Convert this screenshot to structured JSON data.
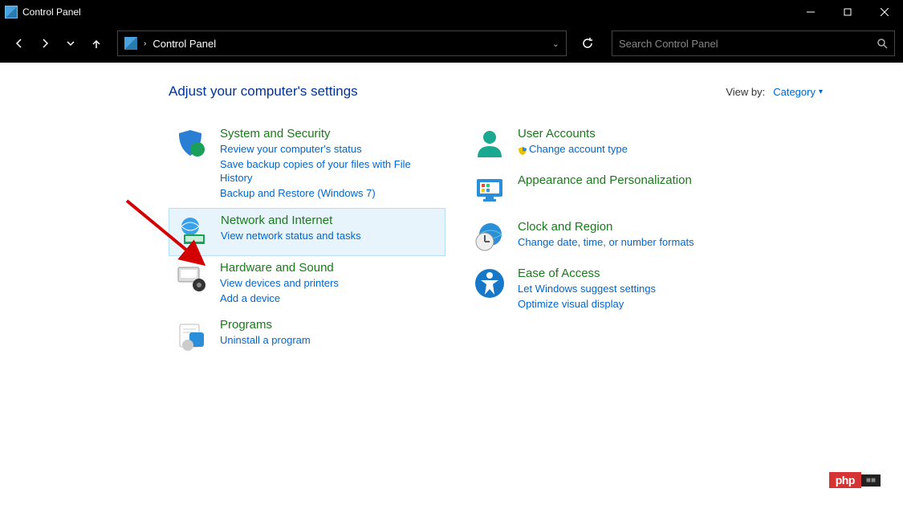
{
  "window": {
    "title": "Control Panel"
  },
  "breadcrumb": {
    "text": "Control Panel"
  },
  "search": {
    "placeholder": "Search Control Panel"
  },
  "header": {
    "title": "Adjust your computer's settings"
  },
  "viewby": {
    "label": "View by:",
    "value": "Category"
  },
  "categories_left": [
    {
      "name": "system-security",
      "title": "System and Security",
      "links": [
        "Review your computer's status",
        "Save backup copies of your files with File History",
        "Backup and Restore (Windows 7)"
      ],
      "highlighted": false
    },
    {
      "name": "network-internet",
      "title": "Network and Internet",
      "links": [
        "View network status and tasks"
      ],
      "highlighted": true
    },
    {
      "name": "hardware-sound",
      "title": "Hardware and Sound",
      "links": [
        "View devices and printers",
        "Add a device"
      ],
      "highlighted": false
    },
    {
      "name": "programs",
      "title": "Programs",
      "links": [
        "Uninstall a program"
      ],
      "highlighted": false
    }
  ],
  "categories_right": [
    {
      "name": "user-accounts",
      "title": "User Accounts",
      "links": [
        "Change account type"
      ],
      "shield": [
        true
      ]
    },
    {
      "name": "appearance-personalization",
      "title": "Appearance and Personalization",
      "links": []
    },
    {
      "name": "clock-region",
      "title": "Clock and Region",
      "links": [
        "Change date, time, or number formats"
      ]
    },
    {
      "name": "ease-of-access",
      "title": "Ease of Access",
      "links": [
        "Let Windows suggest settings",
        "Optimize visual display"
      ]
    }
  ],
  "watermark": {
    "php": "php",
    "cn": "■■"
  }
}
